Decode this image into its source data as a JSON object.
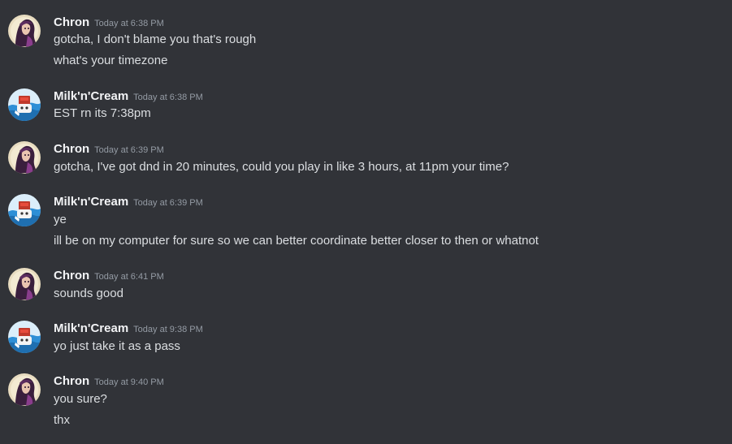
{
  "users": {
    "chron": {
      "name": "Chron",
      "avatar_icon": "chron-avatar-icon"
    },
    "milk": {
      "name": "Milk'n'Cream",
      "avatar_icon": "milkncream-avatar-icon"
    }
  },
  "messages": [
    {
      "author": "Chron",
      "time": "Today at 6:38 PM",
      "lines": [
        "gotcha, I don't blame you that's rough",
        "what's your timezone"
      ]
    },
    {
      "author": "Milk'n'Cream",
      "time": "Today at 6:38 PM",
      "lines": [
        "EST rn its 7:38pm"
      ]
    },
    {
      "author": "Chron",
      "time": "Today at 6:39 PM",
      "lines": [
        "gotcha, I've got dnd in 20 minutes, could you play in like 3 hours, at 11pm your time?"
      ]
    },
    {
      "author": "Milk'n'Cream",
      "time": "Today at 6:39 PM",
      "lines": [
        "ye",
        "ill be on my computer for sure so we can better coordinate better closer to then or whatnot"
      ]
    },
    {
      "author": "Chron",
      "time": "Today at 6:41 PM",
      "lines": [
        "sounds good"
      ]
    },
    {
      "author": "Milk'n'Cream",
      "time": "Today at 9:38 PM",
      "lines": [
        "yo just take it as a pass"
      ]
    },
    {
      "author": "Chron",
      "time": "Today at 9:40 PM",
      "lines": [
        "you sure?",
        "thx"
      ]
    }
  ],
  "colors": {
    "background": "#313338",
    "username": "#f2f3f5",
    "timestamp": "#949ba4",
    "text": "#dbdee1"
  }
}
